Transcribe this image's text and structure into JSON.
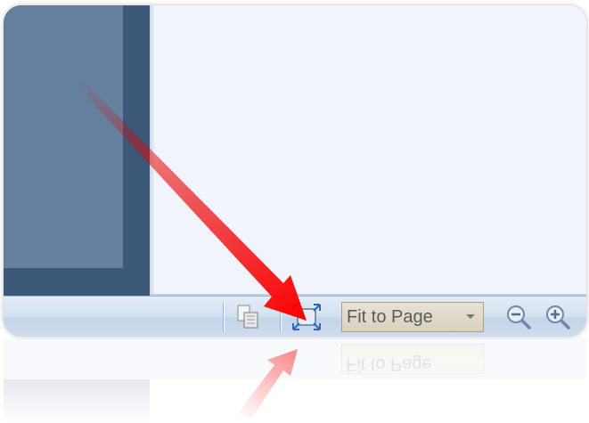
{
  "statusbar": {
    "zoom": {
      "value": "Fit to Page"
    },
    "icons": {
      "page_layout": "page-layout-icon",
      "fit_to_page": "fit-to-page-icon",
      "zoom_out": "zoom-out-icon",
      "zoom_in": "zoom-in-icon",
      "dropdown": "chevron-down-icon"
    }
  },
  "annotation": {
    "pointer": "red-arrow-icon",
    "color": "#e60000"
  },
  "colors": {
    "sidebar_dark": "#3c5878",
    "sidebar_light": "#64809e",
    "page_background": "#f1f4fb",
    "statusbar": "#d5e2f0",
    "zoom_box": "#ddd6c6"
  }
}
